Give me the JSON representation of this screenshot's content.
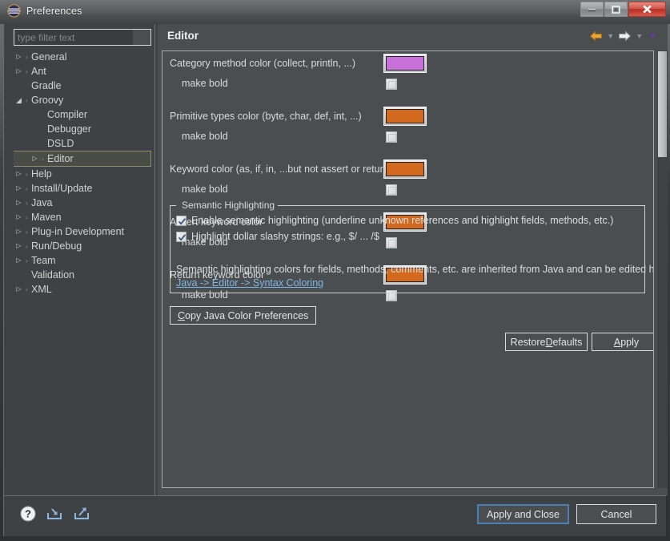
{
  "window": {
    "title": "Preferences",
    "app_icon": "eclipse-globe-icon",
    "minimize_label": "Minimize",
    "maximize_label": "Maximize",
    "close_label": "Close"
  },
  "sidebar": {
    "filter": {
      "placeholder": "type filter text",
      "value": ""
    },
    "items": [
      {
        "label": "General",
        "level": 1,
        "expandable": true,
        "expanded": false,
        "selected": false
      },
      {
        "label": "Ant",
        "level": 1,
        "expandable": true,
        "expanded": false,
        "selected": false
      },
      {
        "label": "Gradle",
        "level": 1,
        "expandable": false,
        "expanded": false,
        "selected": false
      },
      {
        "label": "Groovy",
        "level": 1,
        "expandable": true,
        "expanded": true,
        "selected": false
      },
      {
        "label": "Compiler",
        "level": 2,
        "expandable": false,
        "expanded": false,
        "selected": false
      },
      {
        "label": "Debugger",
        "level": 2,
        "expandable": false,
        "expanded": false,
        "selected": false
      },
      {
        "label": "DSLD",
        "level": 2,
        "expandable": false,
        "expanded": false,
        "selected": false
      },
      {
        "label": "Editor",
        "level": 2,
        "expandable": true,
        "expanded": false,
        "selected": true
      },
      {
        "label": "Help",
        "level": 1,
        "expandable": true,
        "expanded": false,
        "selected": false
      },
      {
        "label": "Install/Update",
        "level": 1,
        "expandable": true,
        "expanded": false,
        "selected": false
      },
      {
        "label": "Java",
        "level": 1,
        "expandable": true,
        "expanded": false,
        "selected": false
      },
      {
        "label": "Maven",
        "level": 1,
        "expandable": true,
        "expanded": false,
        "selected": false
      },
      {
        "label": "Plug-in Development",
        "level": 1,
        "expandable": true,
        "expanded": false,
        "selected": false
      },
      {
        "label": "Run/Debug",
        "level": 1,
        "expandable": true,
        "expanded": false,
        "selected": false
      },
      {
        "label": "Team",
        "level": 1,
        "expandable": true,
        "expanded": false,
        "selected": false
      },
      {
        "label": "Validation",
        "level": 1,
        "expandable": false,
        "expanded": false,
        "selected": false
      },
      {
        "label": "XML",
        "level": 1,
        "expandable": true,
        "expanded": false,
        "selected": false
      }
    ]
  },
  "page": {
    "title": "Editor",
    "nav": {
      "back_icon": "back-arrow-icon",
      "back_color": "#e8a33d",
      "forward_icon": "forward-arrow-icon",
      "forward_color": "#e8eaeb",
      "menu_icon": "chevron-down-icon",
      "menu_color": "#5c3f8f"
    },
    "color_rows": [
      {
        "label": "Category method color (collect, println, ...)",
        "color": "#c96fd9",
        "bold_label": "make bold",
        "bold_checked": false
      },
      {
        "label": "Primitive types color (byte, char, def, int, ...)",
        "color": "#d2691e",
        "bold_label": "make bold",
        "bold_checked": false
      },
      {
        "label": "Keyword color (as, if, in, ...but not assert or return)",
        "color": "#d2691e",
        "bold_label": "make bold",
        "bold_checked": false
      },
      {
        "label": "Assert keyword color",
        "color": "#d2691e",
        "bold_label": "make bold",
        "bold_checked": false
      },
      {
        "label": "Return keyword color",
        "color": "#d2691e",
        "bold_label": "make bold",
        "bold_checked": false
      }
    ],
    "semantic_group": {
      "legend": "Semantic Highlighting",
      "checks": [
        {
          "label": "Enable semantic highlighting (underline unknown references and highlight fields, methods, etc.)",
          "checked": true
        },
        {
          "label": "Highlight dollar slashy strings: e.g., $/ ... /$",
          "checked": true
        }
      ],
      "note": "Semantic highlighting colors for fields, methods, comments, etc. are inherited from Java and can be edited here:",
      "link": "Java -> Editor -> Syntax Coloring",
      "link_color": "#7fb6e6"
    },
    "copy_button": {
      "pre": "C",
      "rest": "opy Java Color Preferences"
    },
    "restore_button": {
      "pre": "Restore ",
      "mn": "D",
      "rest": "efaults"
    },
    "apply_button": {
      "mn": "A",
      "rest": "pply"
    }
  },
  "bottom": {
    "icons": [
      {
        "name": "help-icon",
        "title": "Help"
      },
      {
        "name": "import-icon",
        "title": "Import preferences"
      },
      {
        "name": "export-icon",
        "title": "Export preferences"
      }
    ],
    "apply_and_close": "Apply and Close",
    "cancel": "Cancel"
  }
}
